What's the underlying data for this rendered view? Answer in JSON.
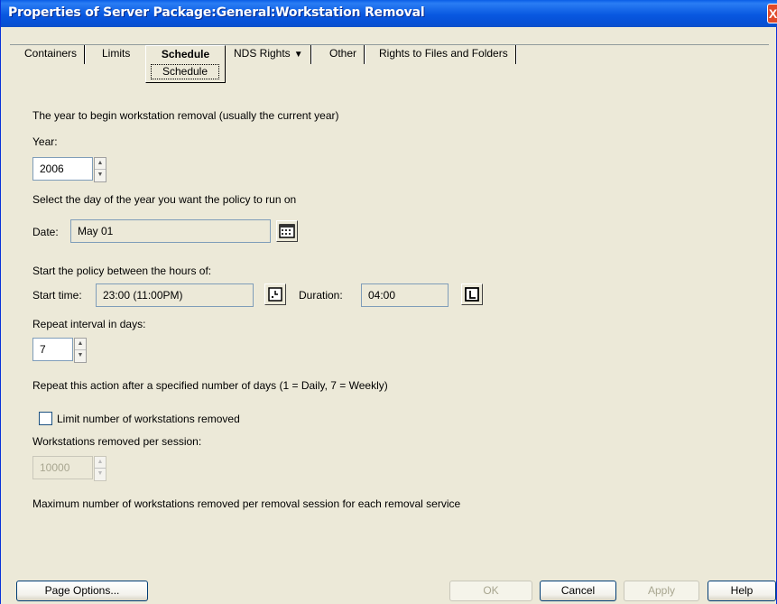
{
  "window": {
    "title": "Properties of Server Package:General:Workstation Removal",
    "close_glyph": "X"
  },
  "tabs": [
    {
      "label": "Containers"
    },
    {
      "label": "Limits"
    },
    {
      "label": "Schedule",
      "active": true,
      "subtab": "Schedule"
    },
    {
      "label": "NDS Rights",
      "has_dropdown": true
    },
    {
      "label": "Other"
    },
    {
      "label": "Rights to Files and Folders"
    }
  ],
  "form": {
    "year_intro": "The year to begin workstation removal (usually the current year)",
    "year_label": "Year:",
    "year_value": "2006",
    "date_intro": "Select the day of the year you want the policy to run on",
    "date_label": "Date:",
    "date_value": "May 01",
    "hours_intro": "Start the policy between the hours of:",
    "start_time_label": "Start time:",
    "start_time_value": "23:00 (11:00PM)",
    "duration_label": "Duration:",
    "duration_value": "04:00",
    "repeat_label": "Repeat interval in days:",
    "repeat_value": "7",
    "repeat_help": "Repeat this action after a specified number of days (1 = Daily, 7 = Weekly)",
    "limit_checkbox_label": "Limit number of workstations removed",
    "limit_checked": false,
    "per_session_label": "Workstations removed per session:",
    "per_session_value": "10000",
    "per_session_help": "Maximum number of workstations removed per removal session for each removal service"
  },
  "buttons": {
    "page_options": "Page Options...",
    "ok": "OK",
    "cancel": "Cancel",
    "apply": "Apply",
    "help": "Help"
  },
  "colors": {
    "titlebar": "#0858e0",
    "dialog_bg": "#ece9d8",
    "close_button": "#e04a2a"
  }
}
